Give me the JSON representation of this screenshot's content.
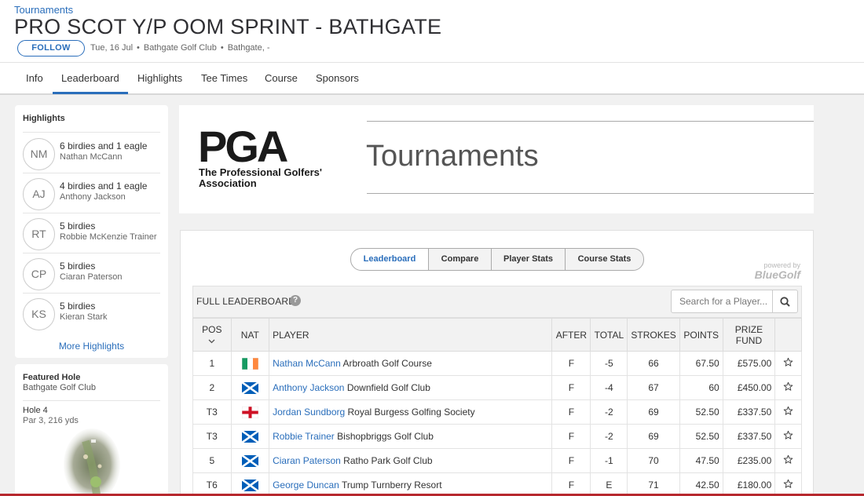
{
  "header": {
    "breadcrumb": "Tournaments",
    "title": "PRO SCOT Y/P OOM SPRINT - BATHGATE",
    "follow_label": "FOLLOW",
    "date": "Tue, 16 Jul",
    "venue": "Bathgate Golf Club",
    "location": "Bathgate, -",
    "separator": "•"
  },
  "nav": {
    "tabs": [
      "Info",
      "Leaderboard",
      "Highlights",
      "Tee Times",
      "Course",
      "Sponsors"
    ],
    "active": "Leaderboard"
  },
  "highlights": {
    "title": "Highlights",
    "items": [
      {
        "initials": "NM",
        "text": "6 birdies and 1 eagle",
        "player": "Nathan McCann"
      },
      {
        "initials": "AJ",
        "text": "4 birdies and 1 eagle",
        "player": "Anthony Jackson"
      },
      {
        "initials": "RT",
        "text": "5 birdies",
        "player": "Robbie McKenzie Trainer"
      },
      {
        "initials": "CP",
        "text": "5 birdies",
        "player": "Ciaran Paterson"
      },
      {
        "initials": "KS",
        "text": "5 birdies",
        "player": "Kieran Stark"
      }
    ],
    "more_label": "More Highlights"
  },
  "featured_hole": {
    "title": "Featured Hole",
    "course": "Bathgate Golf Club",
    "hole": "Hole 4",
    "details": "Par 3, 216 yds"
  },
  "banner": {
    "logo_text": "PGA",
    "logo_sub1": "The Professional Golfers'",
    "logo_sub2": "Association",
    "heading": "Tournaments"
  },
  "leaderboard": {
    "segments": [
      "Leaderboard",
      "Compare",
      "Player Stats",
      "Course Stats"
    ],
    "active_segment": "Leaderboard",
    "powered_by": "powered by",
    "powered_brand": "BlueGolf",
    "full_label": "FULL LEADERBOARD",
    "help_glyph": "?",
    "search_placeholder": "Search for a Player...",
    "columns": {
      "pos": "POS",
      "nat": "NAT",
      "player": "PLAYER",
      "after": "AFTER",
      "total": "TOTAL",
      "strokes": "STROKES",
      "points": "POINTS",
      "prize_line1": "PRIZE",
      "prize_line2": "FUND"
    },
    "rows": [
      {
        "pos": "1",
        "flag": "ireland",
        "player": "Nathan McCann",
        "club": "Arbroath Golf Course",
        "after": "F",
        "total": "-5",
        "strokes": "66",
        "points": "67.50",
        "prize": "£575.00"
      },
      {
        "pos": "2",
        "flag": "scotland",
        "player": "Anthony Jackson",
        "club": "Downfield Golf Club",
        "after": "F",
        "total": "-4",
        "strokes": "67",
        "points": "60",
        "prize": "£450.00"
      },
      {
        "pos": "T3",
        "flag": "england",
        "player": "Jordan Sundborg",
        "club": "Royal Burgess Golfing Society",
        "after": "F",
        "total": "-2",
        "strokes": "69",
        "points": "52.50",
        "prize": "£337.50"
      },
      {
        "pos": "T3",
        "flag": "scotland",
        "player": "Robbie Trainer",
        "club": "Bishopbriggs Golf Club",
        "after": "F",
        "total": "-2",
        "strokes": "69",
        "points": "52.50",
        "prize": "£337.50"
      },
      {
        "pos": "5",
        "flag": "scotland",
        "player": "Ciaran Paterson",
        "club": "Ratho Park Golf Club",
        "after": "F",
        "total": "-1",
        "strokes": "70",
        "points": "47.50",
        "prize": "£235.00"
      },
      {
        "pos": "T6",
        "flag": "scotland",
        "player": "George Duncan",
        "club": "Trump Turnberry Resort",
        "after": "F",
        "total": "E",
        "strokes": "71",
        "points": "42.50",
        "prize": "£180.00"
      }
    ]
  },
  "colors": {
    "link": "#2a6ebb",
    "negative": "#d0312d",
    "bottom_bar": "#b7282e"
  }
}
